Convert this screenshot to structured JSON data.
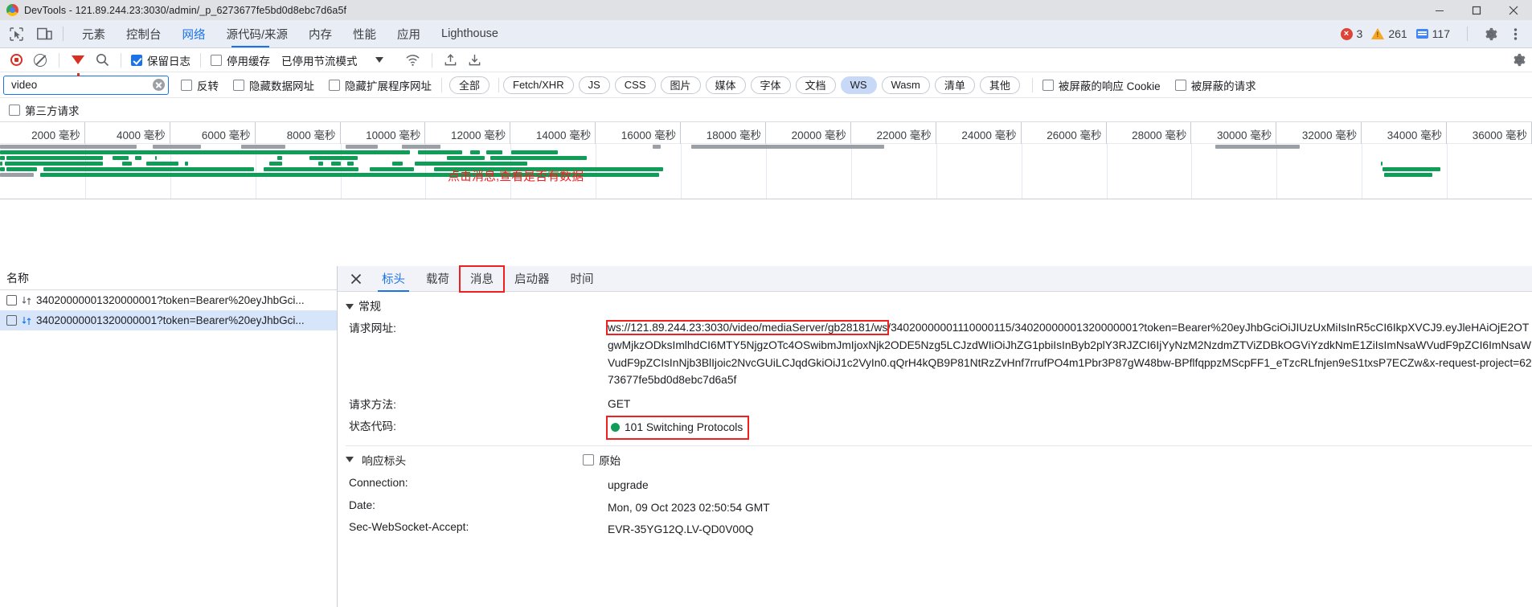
{
  "window": {
    "title": "DevTools - 121.89.244.23:3030/admin/_p_6273677fe5bd0d8ebc7d6a5f",
    "minimize_label": "Minimize",
    "maximize_label": "Maximize",
    "close_label": "Close"
  },
  "devtools_tabs": {
    "items": [
      {
        "label": "元素",
        "active": false
      },
      {
        "label": "控制台",
        "active": false
      },
      {
        "label": "网络",
        "active": true
      },
      {
        "label": "源代码/来源",
        "active": false
      },
      {
        "label": "内存",
        "active": false
      },
      {
        "label": "性能",
        "active": false
      },
      {
        "label": "应用",
        "active": false
      },
      {
        "label": "Lighthouse",
        "active": false
      }
    ],
    "counts": {
      "errors": "3",
      "warnings": "261",
      "info": "117"
    }
  },
  "network_toolbar": {
    "record_label": "停止记录网络日志",
    "clear_label": "清除",
    "filter_label": "过滤",
    "search_label": "搜索",
    "preserve_log": {
      "label": "保留日志",
      "checked": true
    },
    "disable_cache": {
      "label": "停用缓存",
      "checked": false
    },
    "throttling": {
      "label": "已停用节流模式"
    },
    "wifi_label": "网络状况",
    "import_label": "导入 HAR 文件",
    "export_label": "导出 HAR 文件",
    "settings_label": "网络设置"
  },
  "filter_row": {
    "search": {
      "value": "video",
      "placeholder": "过滤"
    },
    "invert": {
      "label": "反转",
      "checked": false
    },
    "hide_data_urls": {
      "label": "隐藏数据网址",
      "checked": false
    },
    "hide_ext_urls": {
      "label": "隐藏扩展程序网址",
      "checked": false
    },
    "types": [
      {
        "label": "全部",
        "selected": false
      },
      {
        "label": "Fetch/XHR",
        "selected": false
      },
      {
        "label": "JS",
        "selected": false
      },
      {
        "label": "CSS",
        "selected": false
      },
      {
        "label": "图片",
        "selected": false
      },
      {
        "label": "媒体",
        "selected": false
      },
      {
        "label": "字体",
        "selected": false
      },
      {
        "label": "文档",
        "selected": false
      },
      {
        "label": "WS",
        "selected": true
      },
      {
        "label": "Wasm",
        "selected": false
      },
      {
        "label": "清单",
        "selected": false
      },
      {
        "label": "其他",
        "selected": false
      }
    ],
    "blocked_cookies": {
      "label": "被屏蔽的响应 Cookie",
      "checked": false
    },
    "blocked_requests": {
      "label": "被屏蔽的请求",
      "checked": false
    },
    "third_party": {
      "label": "第三方请求",
      "checked": false
    }
  },
  "timeline": {
    "ticks": [
      "2000 毫秒",
      "4000 毫秒",
      "6000 毫秒",
      "8000 毫秒",
      "10000 毫秒",
      "12000 毫秒",
      "14000 毫秒",
      "16000 毫秒",
      "18000 毫秒",
      "20000 毫秒",
      "22000 毫秒",
      "24000 毫秒",
      "26000 毫秒",
      "28000 毫秒",
      "30000 毫秒",
      "32000 毫秒",
      "34000 毫秒",
      "36000 毫秒"
    ],
    "annotation": "点击消息,查看是否有数据"
  },
  "request_list": {
    "column_header": "名称",
    "rows": [
      {
        "name": "34020000001320000001?token=Bearer%20eyJhbGci...",
        "selected": false
      },
      {
        "name": "34020000001320000001?token=Bearer%20eyJhbGci...",
        "selected": true
      }
    ]
  },
  "detail_panel": {
    "close_label": "关闭",
    "tabs": [
      {
        "label": "标头",
        "active": true,
        "highlighted": false
      },
      {
        "label": "载荷",
        "active": false,
        "highlighted": false
      },
      {
        "label": "消息",
        "active": false,
        "highlighted": true
      },
      {
        "label": "启动器",
        "active": false,
        "highlighted": false
      },
      {
        "label": "时间",
        "active": false,
        "highlighted": false
      }
    ],
    "general": {
      "section_title": "常规",
      "request_url_label": "请求网址:",
      "request_url_highlight": "ws://121.89.244.23:3030/video/mediaServer/gb28181/ws",
      "request_url_rest": "/34020000001110000115/34020000001320000001?token=Bearer%20eyJhbGciOiJIUzUxMiIsInR5cCI6IkpXVCJ9.eyJleHAiOjE2OTgwMjkzODksImlhdCI6MTY5NjgzOTc4OSwibmJmIjoxNjk2ODE5Nzg5LCJzdWIiOiJhZG1pbiIsInByb2plY3RJZCI6IjYyNzM2NzdmZTViZDBkOGViYzdkNmE1ZiIsImNsaWVudF9pZCI6ImNsaWVudF9pZCIsInNjb3BlIjoic2NvcGUiLCJqdGkiOiJ1c2VyIn0.qQrH4kQB9P81NtRzZvHnf7rrufPO4m1Pbr3P87gW48bw-BPflfqppzMScpFF1_eTzcRLfnjen9eS1txsP7ECZw&x-request-project=6273677fe5bd0d8ebc7d6a5f",
      "request_method_label": "请求方法:",
      "request_method_value": "GET",
      "status_code_label": "状态代码:",
      "status_code_value": "101 Switching Protocols",
      "status_color": "#0f9d58"
    },
    "response_headers": {
      "section_title": "响应标头",
      "raw_label": "原始",
      "raw_checked": false,
      "rows": [
        {
          "key": "Connection:",
          "value": "upgrade"
        },
        {
          "key": "Date:",
          "value": "Mon, 09 Oct 2023 02:50:54 GMT"
        },
        {
          "key": "Sec-WebSocket-Accept:",
          "value": "EVR-35YG12Q.LV-QD0V00Q"
        }
      ]
    }
  },
  "colors": {
    "accent": "#1a73e8",
    "success": "#0f9d58",
    "danger": "#f02020",
    "chrome_bg": "#e9edf5"
  }
}
